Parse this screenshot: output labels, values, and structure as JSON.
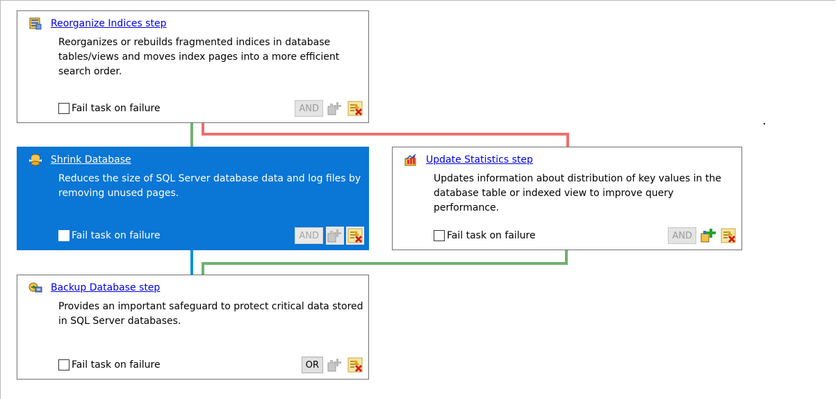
{
  "colors": {
    "success_wire": "#70b070",
    "failure_wire": "#ef6f6f",
    "selected_wire": "#0a8fe0",
    "selected_card": "#0a76d6"
  },
  "steps": [
    {
      "icon": "reorganize-indices-icon",
      "title": "Reorganize Indices step",
      "description": "Reorganizes or rebuilds fragmented indices in database tables/views and moves index pages into a more efficient search order.",
      "fail_label": "Fail task on failure",
      "fail_checked": false,
      "logic": "AND",
      "selected": false
    },
    {
      "icon": "shrink-database-icon",
      "title": "Shrink Database",
      "description": "Reduces the size of SQL Server database data and log files by removing unused pages.",
      "fail_label": "Fail task on failure",
      "fail_checked": false,
      "logic": "AND",
      "selected": true
    },
    {
      "icon": "update-statistics-icon",
      "title": "Update Statistics step",
      "description": "Updates information about distribution of key values in the database table or indexed view to improve query performance.",
      "fail_label": "Fail task on failure",
      "fail_checked": false,
      "logic": "AND",
      "selected": false
    },
    {
      "icon": "backup-database-icon",
      "title": "Backup Database step",
      "description": "Provides an important safeguard to protect critical data stored in SQL Server databases.",
      "fail_label": "Fail task on failure",
      "fail_checked": false,
      "logic": "OR",
      "selected": false
    }
  ]
}
